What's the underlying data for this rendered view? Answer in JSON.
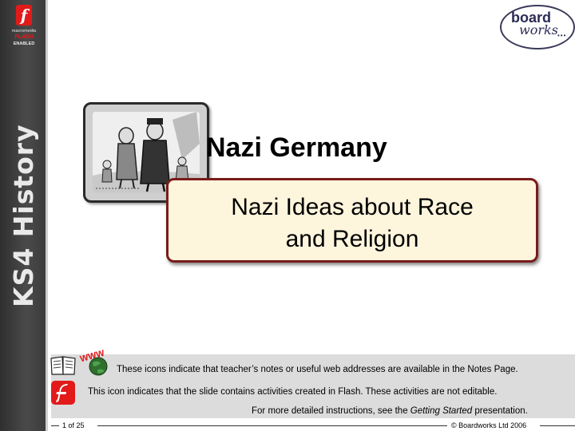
{
  "side_band": {
    "flash_logo_letter": "f",
    "flash_line1": "macromedia",
    "flash_line2": "FLASH",
    "flash_line3": "ENABLED",
    "title": "KS4 History"
  },
  "logo": {
    "line1": "board",
    "line2": "works",
    "dots": "•••"
  },
  "slide": {
    "title": "Nazi Germany",
    "subtitle_line1": "Nazi Ideas about Race",
    "subtitle_line2": "and Religion"
  },
  "info": {
    "www_label": "WWW",
    "line1": "These icons indicate that teacher’s notes or useful web addresses are available in the Notes Page.",
    "line2": "This icon indicates that the slide contains activities created in Flash. These activities are not editable.",
    "line3_before": "For more detailed instructions, see the ",
    "line3_emph": "Getting Started",
    "line3_after": " presentation."
  },
  "footer": {
    "slide_counter": "1 of 25",
    "copyright": "© Boardworks Ltd 2006"
  },
  "colors": {
    "side_band": "#3a3a3a",
    "subtitle_fill": "#fdf5dc",
    "subtitle_border": "#7a1b1b",
    "flash_red": "#e21a1a",
    "logo_navy": "#2b2b55"
  }
}
